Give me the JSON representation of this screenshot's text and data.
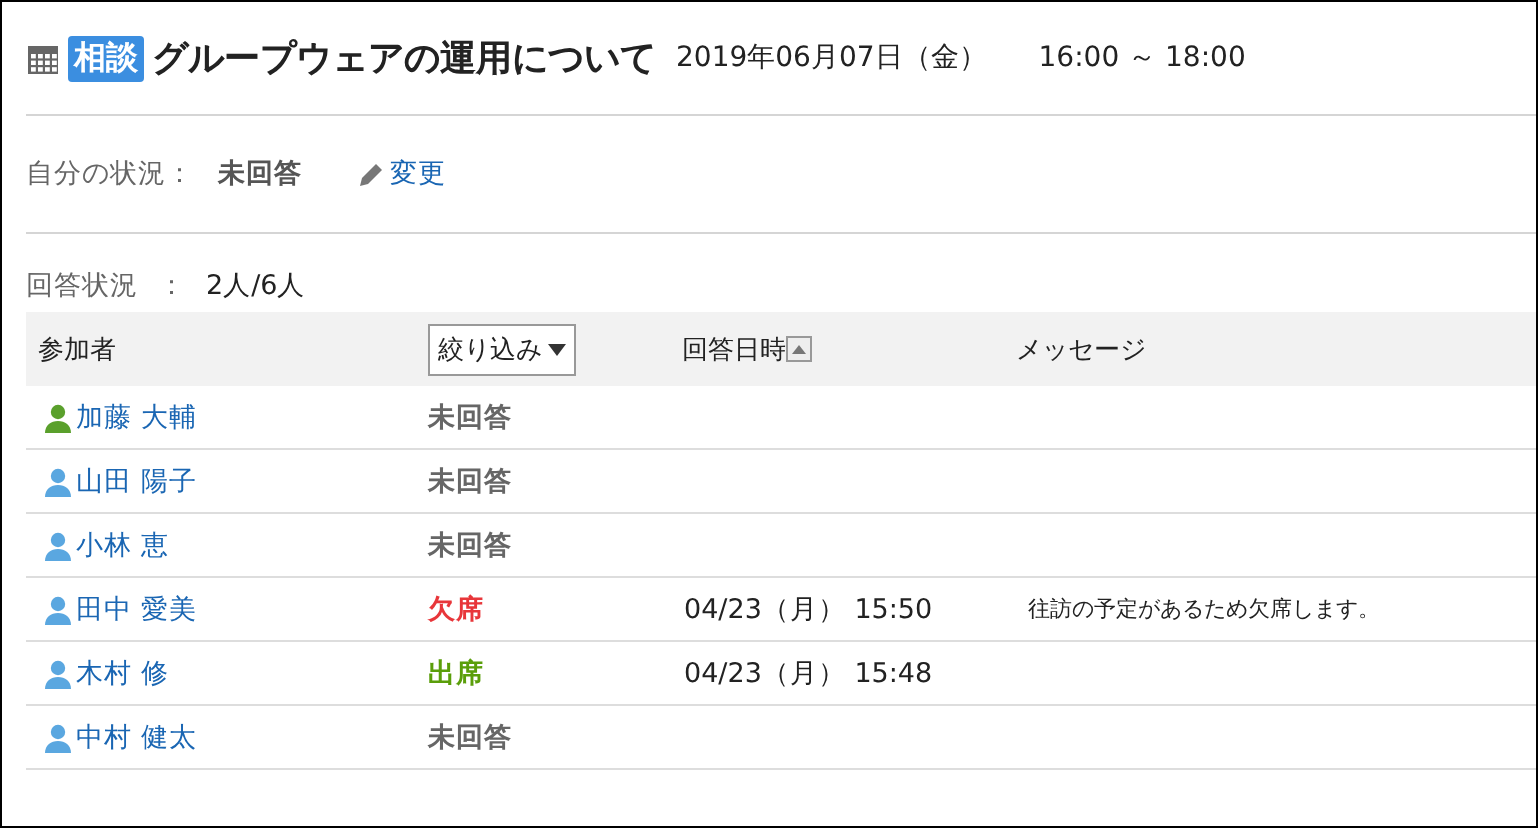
{
  "header": {
    "tag": "相談",
    "title": "グループウェアの運用について",
    "date": "2019年06月07日（金）",
    "time": "16:00 ～ 18:00"
  },
  "my_status": {
    "label": "自分の状況：",
    "value": "未回答",
    "change_link": "変更"
  },
  "response_count": {
    "label": "回答状況",
    "separator": "：",
    "value": "2人/6人"
  },
  "table": {
    "columns": {
      "participant": "参加者",
      "filter": "絞り込み",
      "answered_at": "回答日時",
      "message": "メッセージ"
    },
    "rows": [
      {
        "name": "加藤 大輔",
        "color": "#5aa02c",
        "status": "未回答",
        "kind": "none",
        "answered_at": "",
        "message": ""
      },
      {
        "name": "山田 陽子",
        "color": "#5aa7e0",
        "status": "未回答",
        "kind": "none",
        "answered_at": "",
        "message": ""
      },
      {
        "name": "小林 恵",
        "color": "#5aa7e0",
        "status": "未回答",
        "kind": "none",
        "answered_at": "",
        "message": ""
      },
      {
        "name": "田中 愛美",
        "color": "#5aa7e0",
        "status": "欠席",
        "kind": "absent",
        "answered_at": "04/23（月） 15:50",
        "message": "往訪の予定があるため欠席します。"
      },
      {
        "name": "木村 修",
        "color": "#5aa7e0",
        "status": "出席",
        "kind": "present",
        "answered_at": "04/23（月） 15:48",
        "message": ""
      },
      {
        "name": "中村 健太",
        "color": "#5aa7e0",
        "status": "未回答",
        "kind": "none",
        "answered_at": "",
        "message": ""
      }
    ]
  }
}
